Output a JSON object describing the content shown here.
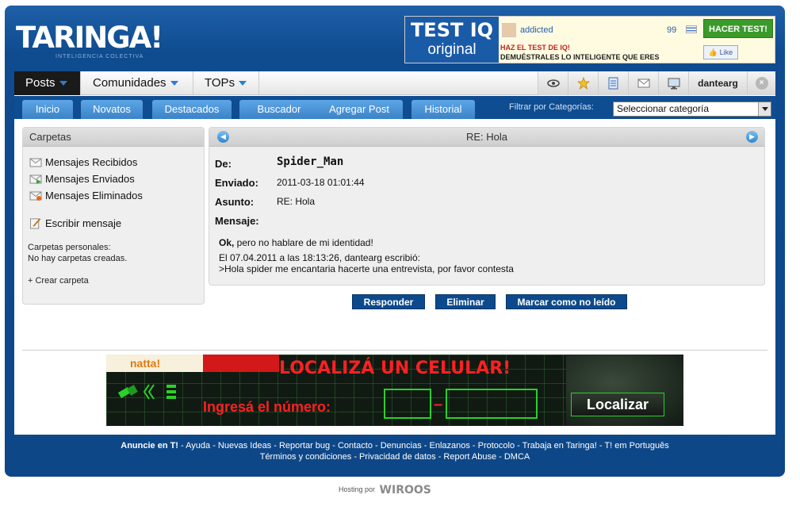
{
  "logo": {
    "name": "TARINGA!",
    "tagline": "INTELIGENCIA COLECTIVA"
  },
  "ad_top": {
    "title1": "TEST IQ",
    "title2": "original",
    "user": "addicted",
    "score": "99",
    "button": "HACER TEST!",
    "line1": "HAZ EL TEST DE IQ!",
    "line2": "DEMUÉSTRALES LO INTELIGENTE QUE ERES",
    "like": "Like"
  },
  "nav": {
    "tabs": [
      {
        "label": "Posts"
      },
      {
        "label": "Comunidades"
      },
      {
        "label": "TOPs"
      }
    ],
    "username": "dantearg",
    "close_glyph": "×"
  },
  "subnav": {
    "tabs": [
      {
        "label": "Inicio"
      },
      {
        "label": "Novatos"
      },
      {
        "label": "Destacados"
      },
      {
        "label": "Buscador"
      },
      {
        "label": "Agregar Post"
      },
      {
        "label": "Historial"
      }
    ],
    "filter_label": "Filtrar por Categorías:",
    "select_value": "Seleccionar categoría"
  },
  "sidebar": {
    "title": "Carpetas",
    "links": [
      {
        "label": "Mensajes Recibidos"
      },
      {
        "label": "Mensajes Enviados"
      },
      {
        "label": "Mensajes Eliminados"
      }
    ],
    "write": "Escribir mensaje",
    "personal_title": "Carpetas personales:",
    "personal_empty": "No hay carpetas creadas.",
    "create": "+ Crear carpeta"
  },
  "message": {
    "title": "RE: Hola",
    "from_label": "De:",
    "from_value": "Spider_Man",
    "sent_label": "Enviado:",
    "sent_value": "2011-03-18 01:01:44",
    "subject_label": "Asunto:",
    "subject_value": "RE: Hola",
    "message_label": "Mensaje:",
    "body_bold": "Ok,",
    "body_rest": " pero no hablare de mi identidad!",
    "quote_line": "El 07.04.2011 a las 18:13:26, dantearg escribió:",
    "quote_text": ">Hola spider me encantaria hacerte una entrevista, por favor contesta"
  },
  "actions": {
    "reply": "Responder",
    "delete": "Eliminar",
    "unread": "Marcar como no leído"
  },
  "banner": {
    "brand": "natta!",
    "title": "LOCALIZÁ UN CELULAR!",
    "subtitle": "Ingresá el número:",
    "dash": "–",
    "button": "Localizar"
  },
  "footer": {
    "advertise": "Anuncie en T!",
    "line1": " - Ayuda - Nuevas Ideas - Reportar bug - Contacto - Denuncias - Enlazanos - Protocolo - Trabaja en Taringa! - T! em Português",
    "line2": "Términos y condiciones - Privacidad de datos - Report Abuse - DMCA",
    "hosting_label": "Hosting por",
    "hosting_brand": "WIROOS"
  },
  "colors": {
    "frame_blue": "#0d4a8c",
    "tab_blue": "#3b83c8",
    "button_blue": "#0d4a8c",
    "banner_red": "#ff2020",
    "banner_green": "#2bd02b"
  },
  "icons": {
    "nav": [
      "eye-icon",
      "star-icon",
      "document-icon",
      "mail-icon",
      "monitor-icon"
    ],
    "sidebar": [
      "envelope-icon",
      "envelope-send-icon",
      "envelope-delete-icon",
      "compose-icon"
    ],
    "arrows": [
      "arrow-left-icon",
      "arrow-right-icon"
    ]
  }
}
